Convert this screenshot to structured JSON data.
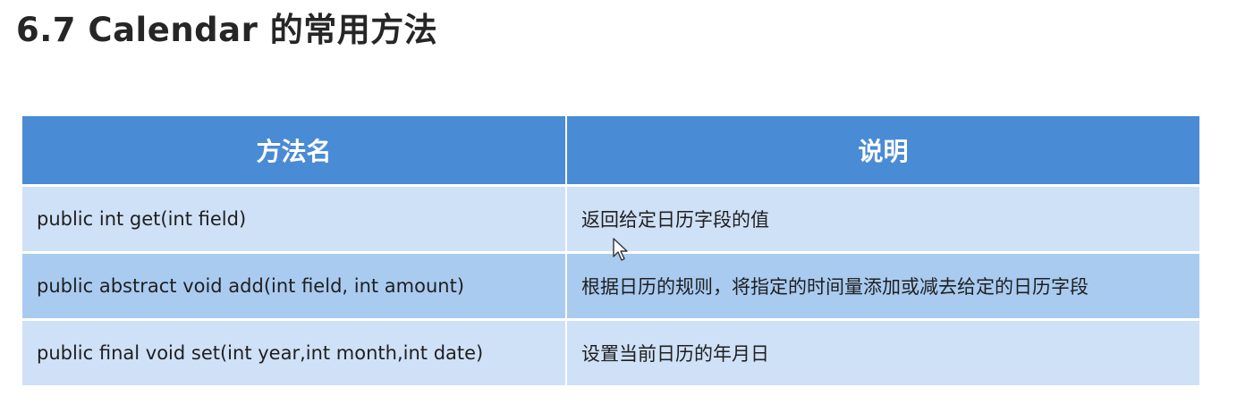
{
  "title": "6.7 Calendar 的常用方法",
  "table": {
    "headers": [
      "方法名",
      "说明"
    ],
    "rows": [
      [
        "public int get(int field)",
        "返回给定日历字段的值"
      ],
      [
        "public abstract void add(int field, int amount)",
        "根据日历的规则，将指定的时间量添加或减去给定的日历字段"
      ],
      [
        "public final void set(int year,int month,int date)",
        "设置当前日历的年月日"
      ]
    ]
  },
  "icons": {
    "cursor": "mouse-pointer-icon"
  },
  "colors": {
    "header_bg": "#4a8bd5",
    "row_light": "#cfe1f7",
    "row_mid": "#a9cbf0",
    "title_text": "#262626"
  }
}
